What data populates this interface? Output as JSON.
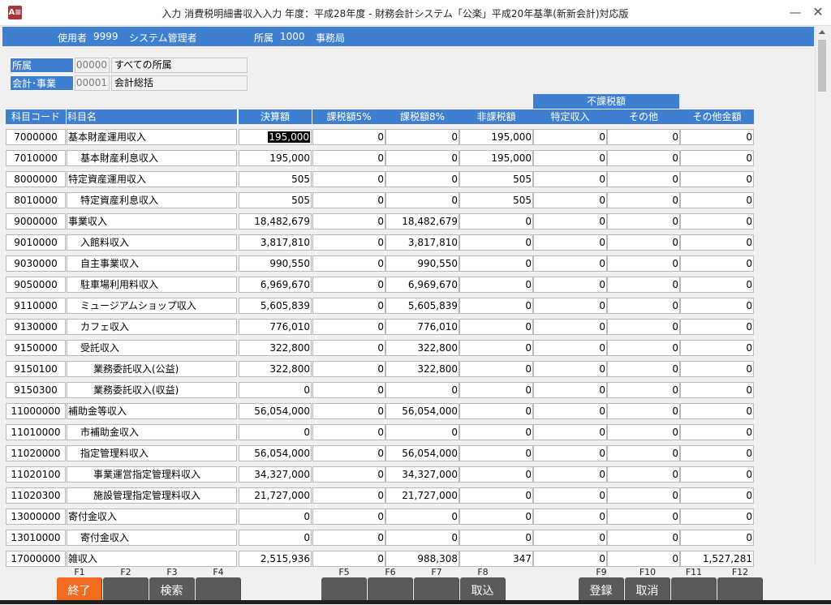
{
  "window": {
    "app_icon": "A≡",
    "title": "入力  消費税明細書収入入力    年度：平成28年度 - 財務会計システム「公楽」平成20年基準(新新会計)対応版",
    "minimize_glyph": "—",
    "close_glyph": "✕"
  },
  "infobar": {
    "user_label": "使用者",
    "user_code": "9999",
    "user_name": "システム管理者",
    "dept_label": "所属",
    "dept_code": "1000",
    "dept_name": "事務局"
  },
  "filters": [
    {
      "label": "所属",
      "code": "00000",
      "name": "すべての所属"
    },
    {
      "label": "会計･事業",
      "code": "00001",
      "name": "会計総括"
    }
  ],
  "grid": {
    "group_header": "不課税額",
    "headers": [
      "科目コード",
      "科目名",
      "決算額",
      "課税額5%",
      "課税額8%",
      "非課税額",
      "特定収入",
      "その他",
      "その他金額"
    ],
    "rows": [
      {
        "code": "7000000",
        "name": "基本財産運用収入",
        "level": 0,
        "vals": [
          "195,000",
          "0",
          "0",
          "195,000",
          "0",
          "0",
          "0"
        ]
      },
      {
        "code": "7010000",
        "name": "基本財産利息収入",
        "level": 1,
        "vals": [
          "195,000",
          "0",
          "0",
          "195,000",
          "0",
          "0",
          "0"
        ]
      },
      {
        "code": "8000000",
        "name": "特定資産運用収入",
        "level": 0,
        "vals": [
          "505",
          "0",
          "0",
          "505",
          "0",
          "0",
          "0"
        ]
      },
      {
        "code": "8010000",
        "name": "特定資産利息収入",
        "level": 1,
        "vals": [
          "505",
          "0",
          "0",
          "505",
          "0",
          "0",
          "0"
        ]
      },
      {
        "code": "9000000",
        "name": "事業収入",
        "level": 0,
        "vals": [
          "18,482,679",
          "0",
          "18,482,679",
          "0",
          "0",
          "0",
          "0"
        ]
      },
      {
        "code": "9010000",
        "name": "入館料収入",
        "level": 1,
        "vals": [
          "3,817,810",
          "0",
          "3,817,810",
          "0",
          "0",
          "0",
          "0"
        ]
      },
      {
        "code": "9030000",
        "name": "自主事業収入",
        "level": 1,
        "vals": [
          "990,550",
          "0",
          "990,550",
          "0",
          "0",
          "0",
          "0"
        ]
      },
      {
        "code": "9050000",
        "name": "駐車場利用料収入",
        "level": 1,
        "vals": [
          "6,969,670",
          "0",
          "6,969,670",
          "0",
          "0",
          "0",
          "0"
        ]
      },
      {
        "code": "9110000",
        "name": "ミュージアムショップ収入",
        "level": 1,
        "vals": [
          "5,605,839",
          "0",
          "5,605,839",
          "0",
          "0",
          "0",
          "0"
        ]
      },
      {
        "code": "9130000",
        "name": "カフェ収入",
        "level": 1,
        "vals": [
          "776,010",
          "0",
          "776,010",
          "0",
          "0",
          "0",
          "0"
        ]
      },
      {
        "code": "9150000",
        "name": "受託収入",
        "level": 1,
        "vals": [
          "322,800",
          "0",
          "322,800",
          "0",
          "0",
          "0",
          "0"
        ]
      },
      {
        "code": "9150100",
        "name": "業務委託収入(公益)",
        "level": 2,
        "vals": [
          "322,800",
          "0",
          "322,800",
          "0",
          "0",
          "0",
          "0"
        ]
      },
      {
        "code": "9150300",
        "name": "業務委託収入(収益)",
        "level": 2,
        "vals": [
          "0",
          "0",
          "0",
          "0",
          "0",
          "0",
          "0"
        ]
      },
      {
        "code": "11000000",
        "name": "補助金等収入",
        "level": 0,
        "vals": [
          "56,054,000",
          "0",
          "56,054,000",
          "0",
          "0",
          "0",
          "0"
        ]
      },
      {
        "code": "11010000",
        "name": "市補助金収入",
        "level": 1,
        "vals": [
          "0",
          "0",
          "0",
          "0",
          "0",
          "0",
          "0"
        ]
      },
      {
        "code": "11020000",
        "name": "指定管理料収入",
        "level": 1,
        "vals": [
          "56,054,000",
          "0",
          "56,054,000",
          "0",
          "0",
          "0",
          "0"
        ]
      },
      {
        "code": "11020100",
        "name": "事業運営指定管理料収入",
        "level": 2,
        "vals": [
          "34,327,000",
          "0",
          "34,327,000",
          "0",
          "0",
          "0",
          "0"
        ]
      },
      {
        "code": "11020300",
        "name": "施設管理指定管理料収入",
        "level": 2,
        "vals": [
          "21,727,000",
          "0",
          "21,727,000",
          "0",
          "0",
          "0",
          "0"
        ]
      },
      {
        "code": "13000000",
        "name": "寄付金収入",
        "level": 0,
        "vals": [
          "0",
          "0",
          "0",
          "0",
          "0",
          "0",
          "0"
        ]
      },
      {
        "code": "13010000",
        "name": "寄付金収入",
        "level": 1,
        "vals": [
          "0",
          "0",
          "0",
          "0",
          "0",
          "0",
          "0"
        ]
      },
      {
        "code": "17000000",
        "name": "雑収入",
        "level": 0,
        "vals": [
          "2,515,936",
          "0",
          "988,308",
          "347",
          "0",
          "0",
          "1,527,281"
        ]
      }
    ]
  },
  "fkeys": [
    {
      "key": "F1",
      "label": "終了"
    },
    {
      "key": "F2",
      "label": ""
    },
    {
      "key": "F3",
      "label": "検索"
    },
    {
      "key": "F4",
      "label": ""
    },
    {
      "key": "F5",
      "label": ""
    },
    {
      "key": "F6",
      "label": ""
    },
    {
      "key": "F7",
      "label": ""
    },
    {
      "key": "F8",
      "label": "取込"
    },
    {
      "key": "F9",
      "label": "登録"
    },
    {
      "key": "F10",
      "label": "取消"
    },
    {
      "key": "F11",
      "label": ""
    },
    {
      "key": "F12",
      "label": ""
    }
  ],
  "colors": {
    "accent": "#3e7fcf",
    "exit_button": "#f36b21",
    "fkey": "#5a5a5a"
  }
}
